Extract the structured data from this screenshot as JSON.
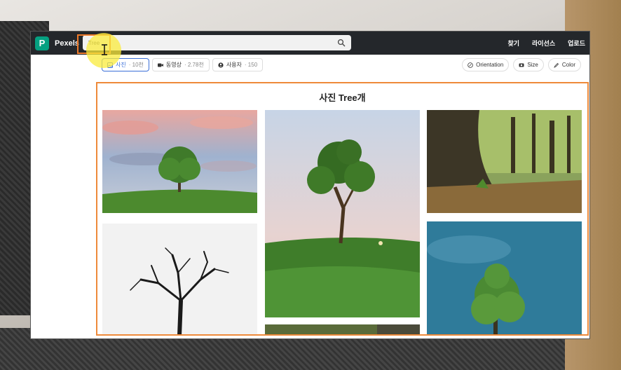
{
  "app": {
    "brand": "Pexels",
    "logo_letter": "P"
  },
  "search": {
    "value": "Tree",
    "placeholder": ""
  },
  "nav": {
    "items": [
      "찾기",
      "라이선스",
      "업로드"
    ]
  },
  "filters": [
    {
      "label": "사진",
      "count": "· 10천",
      "icon": "photo-icon",
      "active": true
    },
    {
      "label": "동영상",
      "count": "· 2.78천",
      "icon": "video-icon",
      "active": false
    },
    {
      "label": "사용자",
      "count": "· 150",
      "icon": "user-icon",
      "active": false
    }
  ],
  "refine": {
    "orientation": "Orientation",
    "size": "Size",
    "color": "Color"
  },
  "page": {
    "heading": "사진 Tree개"
  },
  "colors": {
    "accent": "#05a081",
    "highlight": "#ee8a3a",
    "topbar": "#24272b"
  }
}
